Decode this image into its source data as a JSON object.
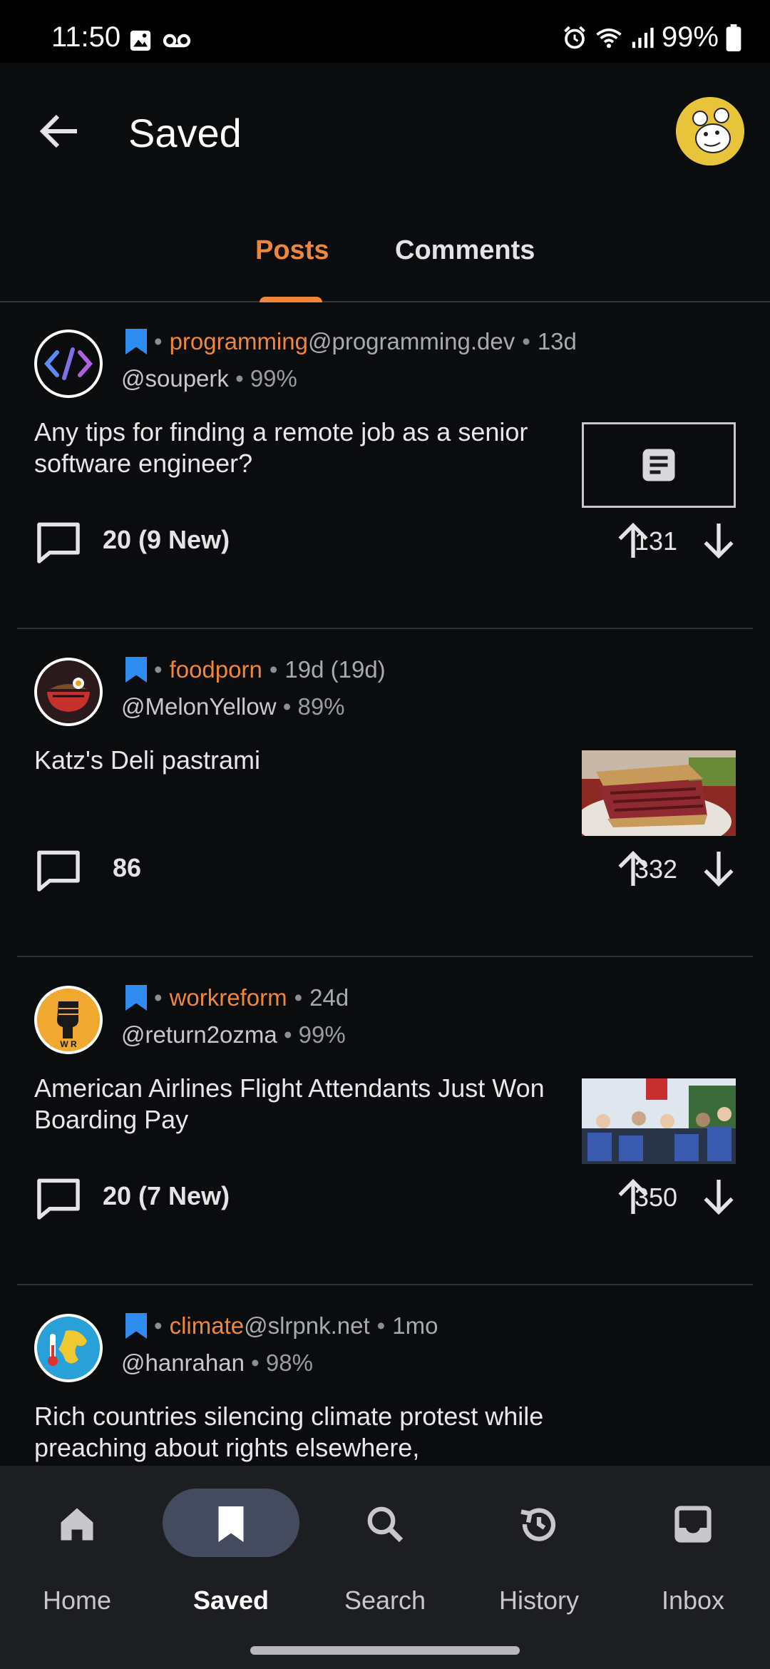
{
  "status_bar": {
    "time": "11:50",
    "battery": "99%"
  },
  "header": {
    "title": "Saved"
  },
  "tabs": [
    {
      "label": "Posts",
      "active": true
    },
    {
      "label": "Comments",
      "active": false
    }
  ],
  "posts": [
    {
      "community": "programming",
      "instance": "@programming.dev",
      "age": "13d",
      "author": "@souperk",
      "ratio": "99%",
      "title": "Any tips for finding a remote job as a senior software engineer?",
      "comments": "20 (9 New)",
      "score": "131",
      "thumbnail": "text-post-icon"
    },
    {
      "community": "foodporn",
      "instance": "",
      "age": "19d (19d)",
      "author": "@MelonYellow",
      "ratio": "89%",
      "title": "Katz's Deli pastrami",
      "comments": "86",
      "score": "332",
      "thumbnail": "sandwich-image"
    },
    {
      "community": "workreform",
      "instance": "",
      "age": "24d",
      "author": "@return2ozma",
      "ratio": "99%",
      "title": "American Airlines Flight Attendants Just Won Boarding Pay",
      "comments": "20 (7 New)",
      "score": "350",
      "thumbnail": "protest-image"
    },
    {
      "community": "climate",
      "instance": "@slrpnk.net",
      "age": "1mo",
      "author": "@hanrahan",
      "ratio": "98%",
      "title": "Rich countries silencing climate protest while preaching about rights elsewhere,",
      "comments": "",
      "score": "",
      "thumbnail": ""
    }
  ],
  "bottom_nav": [
    {
      "label": "Home",
      "icon": "home-icon"
    },
    {
      "label": "Saved",
      "icon": "bookmark-icon",
      "active": true
    },
    {
      "label": "Search",
      "icon": "search-icon"
    },
    {
      "label": "History",
      "icon": "history-icon"
    },
    {
      "label": "Inbox",
      "icon": "inbox-icon"
    }
  ],
  "colors": {
    "accent": "#f0863a",
    "background": "#0b0c0e",
    "bookmark": "#2f8cf0",
    "nav_active": "#444b5e"
  }
}
